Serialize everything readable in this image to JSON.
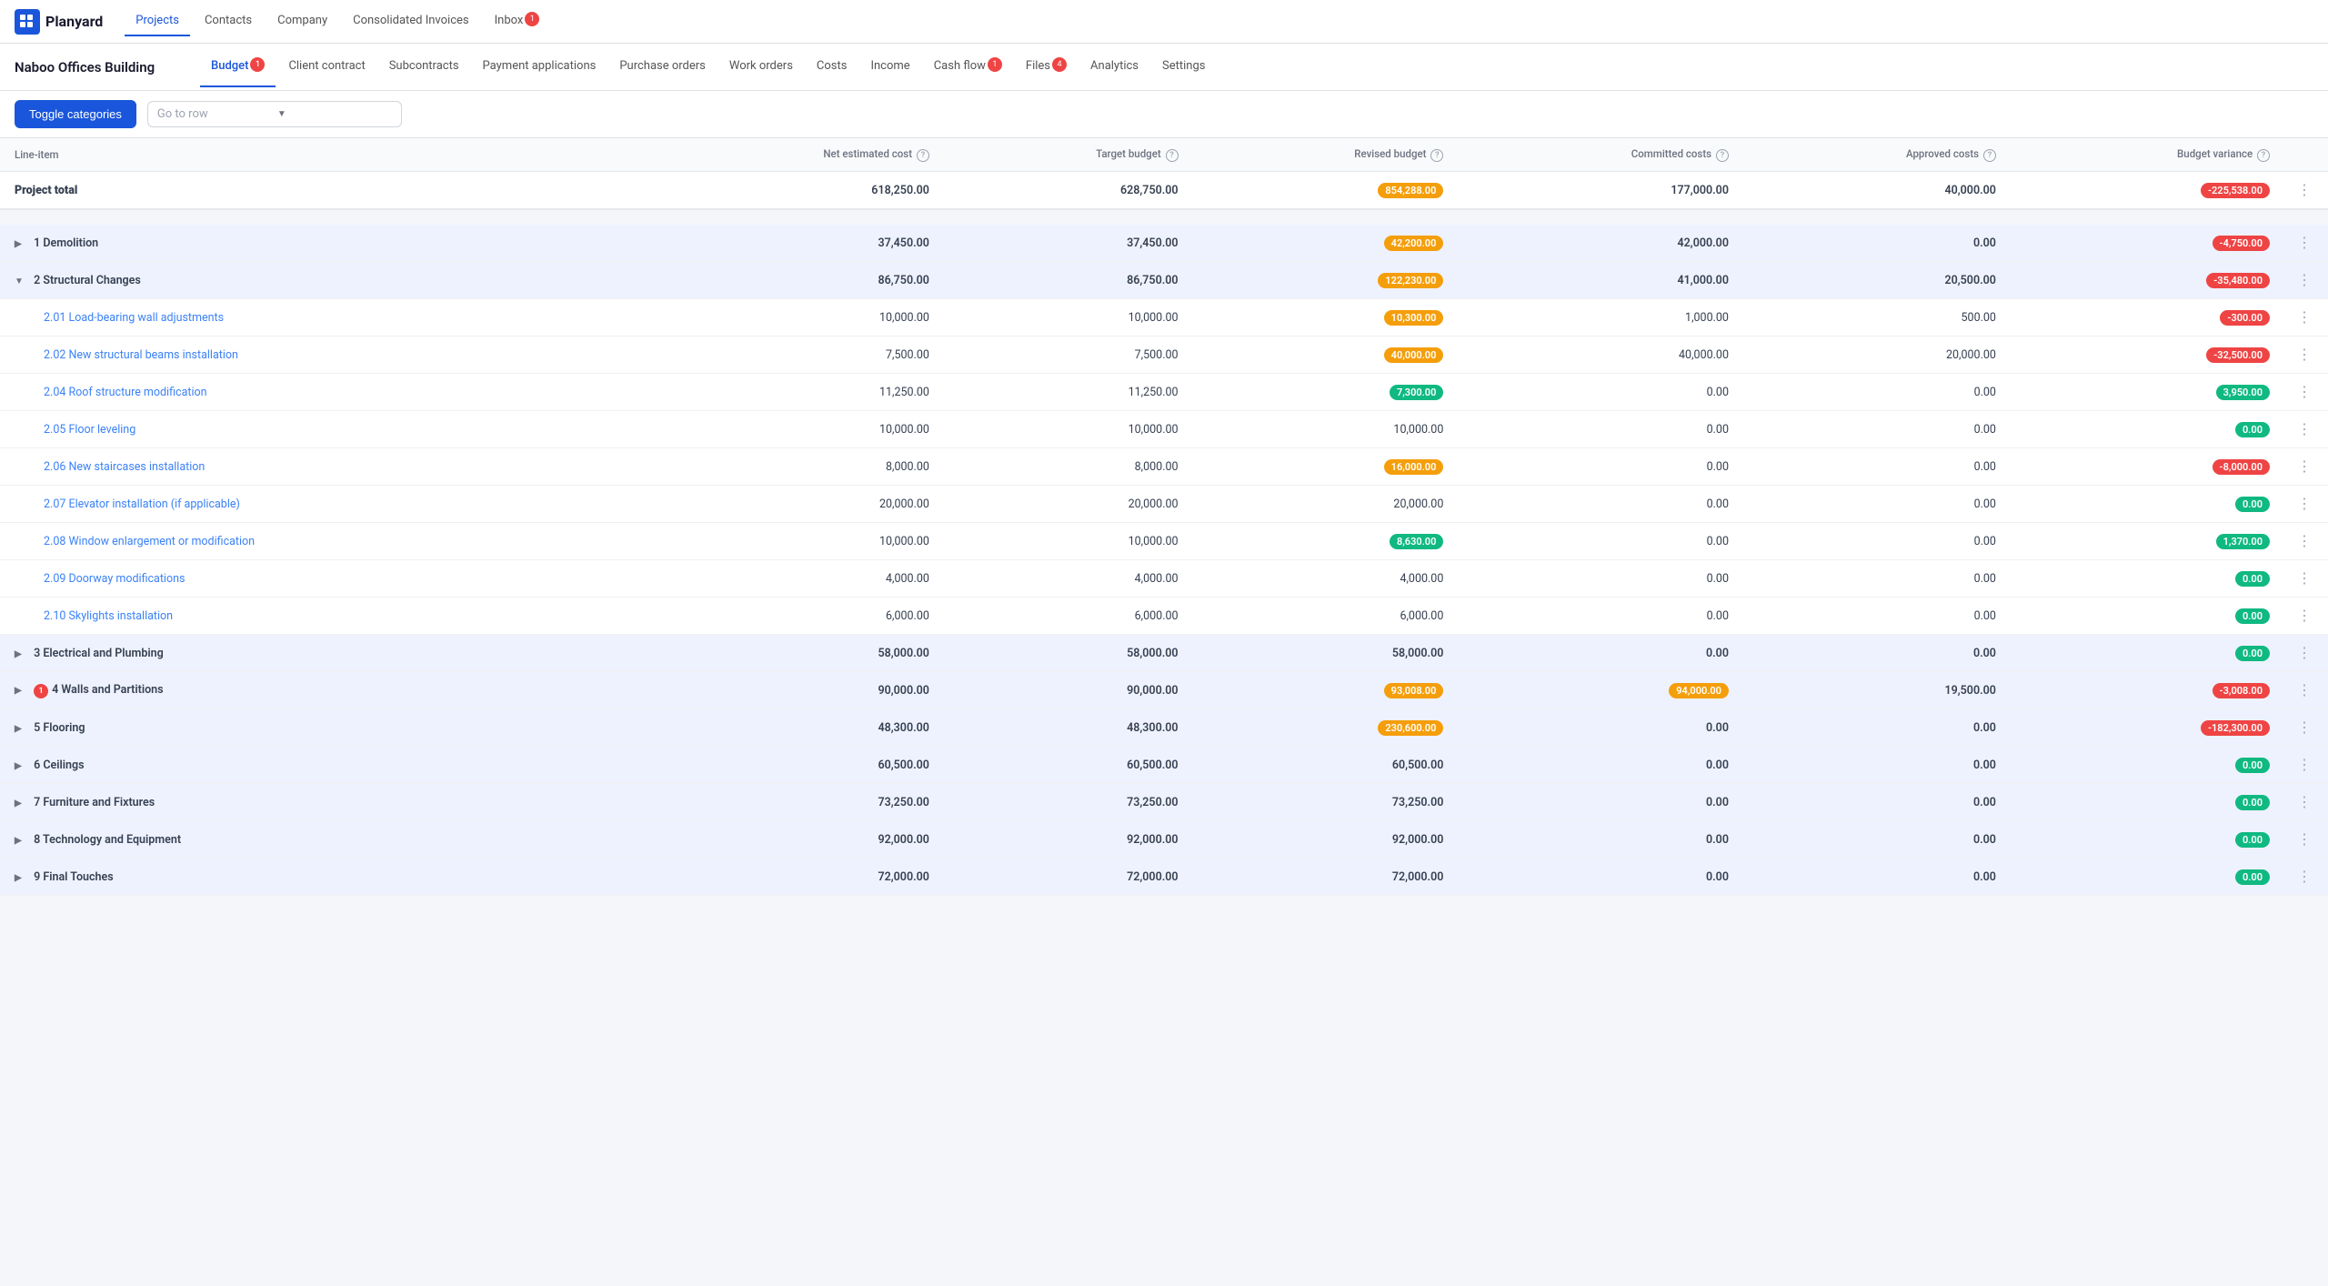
{
  "app": {
    "logo_text": "Planyard",
    "top_nav": [
      {
        "label": "Projects",
        "active": true,
        "badge": null
      },
      {
        "label": "Contacts",
        "active": false,
        "badge": null
      },
      {
        "label": "Company",
        "active": false,
        "badge": null
      },
      {
        "label": "Consolidated Invoices",
        "active": false,
        "badge": null
      },
      {
        "label": "Inbox",
        "active": false,
        "badge": "1"
      }
    ]
  },
  "project": {
    "title": "Naboo Offices Building",
    "sub_nav": [
      {
        "label": "Budget",
        "active": true,
        "badge": "1"
      },
      {
        "label": "Client contract",
        "active": false,
        "badge": null
      },
      {
        "label": "Subcontracts",
        "active": false,
        "badge": null
      },
      {
        "label": "Payment applications",
        "active": false,
        "badge": null
      },
      {
        "label": "Purchase orders",
        "active": false,
        "badge": null
      },
      {
        "label": "Work orders",
        "active": false,
        "badge": null
      },
      {
        "label": "Costs",
        "active": false,
        "badge": null
      },
      {
        "label": "Income",
        "active": false,
        "badge": null
      },
      {
        "label": "Cash flow",
        "active": false,
        "badge": "1"
      },
      {
        "label": "Files",
        "active": false,
        "badge": "4"
      },
      {
        "label": "Analytics",
        "active": false,
        "badge": null
      },
      {
        "label": "Settings",
        "active": false,
        "badge": null
      }
    ]
  },
  "toolbar": {
    "toggle_label": "Toggle categories",
    "go_to_row_placeholder": "Go to row"
  },
  "table": {
    "columns": [
      {
        "key": "line_item",
        "label": "Line-item"
      },
      {
        "key": "net_estimated_cost",
        "label": "Net estimated cost"
      },
      {
        "key": "target_budget",
        "label": "Target budget"
      },
      {
        "key": "revised_budget",
        "label": "Revised budget"
      },
      {
        "key": "committed_costs",
        "label": "Committed costs"
      },
      {
        "key": "approved_costs",
        "label": "Approved costs"
      },
      {
        "key": "budget_variance",
        "label": "Budget variance"
      }
    ],
    "project_total": {
      "label": "Project total",
      "net_estimated_cost": "618,250.00",
      "target_budget": "628,750.00",
      "revised_budget": "854,288.00",
      "revised_budget_style": "orange",
      "committed_costs": "177,000.00",
      "approved_costs": "40,000.00",
      "budget_variance": "-225,538.00",
      "budget_variance_style": "red"
    },
    "rows": [
      {
        "type": "category",
        "id": "1",
        "label": "1 Demolition",
        "expanded": false,
        "net_estimated_cost": "37,450.00",
        "target_budget": "37,450.00",
        "revised_budget": "42,200.00",
        "revised_budget_style": "orange",
        "committed_costs": "42,000.00",
        "approved_costs": "0.00",
        "budget_variance": "-4,750.00",
        "budget_variance_style": "red"
      },
      {
        "type": "category",
        "id": "2",
        "label": "2 Structural Changes",
        "expanded": true,
        "net_estimated_cost": "86,750.00",
        "target_budget": "86,750.00",
        "revised_budget": "122,230.00",
        "revised_budget_style": "orange",
        "committed_costs": "41,000.00",
        "approved_costs": "20,500.00",
        "budget_variance": "-35,480.00",
        "budget_variance_style": "red"
      },
      {
        "type": "sub",
        "label": "2.01 Load-bearing wall adjustments",
        "net_estimated_cost": "10,000.00",
        "target_budget": "10,000.00",
        "revised_budget": "10,300.00",
        "revised_budget_style": "orange",
        "committed_costs": "1,000.00",
        "approved_costs": "500.00",
        "budget_variance": "-300.00",
        "budget_variance_style": "red"
      },
      {
        "type": "sub",
        "label": "2.02 New structural beams installation",
        "net_estimated_cost": "7,500.00",
        "target_budget": "7,500.00",
        "revised_budget": "40,000.00",
        "revised_budget_style": "orange",
        "committed_costs": "40,000.00",
        "approved_costs": "20,000.00",
        "budget_variance": "-32,500.00",
        "budget_variance_style": "red"
      },
      {
        "type": "sub",
        "label": "2.04 Roof structure modification",
        "net_estimated_cost": "11,250.00",
        "target_budget": "11,250.00",
        "revised_budget": "7,300.00",
        "revised_budget_style": "green",
        "committed_costs": "0.00",
        "approved_costs": "0.00",
        "budget_variance": "3,950.00",
        "budget_variance_style": "green"
      },
      {
        "type": "sub",
        "label": "2.05 Floor leveling",
        "net_estimated_cost": "10,000.00",
        "target_budget": "10,000.00",
        "revised_budget": "10,000.00",
        "revised_budget_style": "none",
        "committed_costs": "0.00",
        "approved_costs": "0.00",
        "budget_variance": "0.00",
        "budget_variance_style": "green"
      },
      {
        "type": "sub",
        "label": "2.06 New staircases installation",
        "net_estimated_cost": "8,000.00",
        "target_budget": "8,000.00",
        "revised_budget": "16,000.00",
        "revised_budget_style": "orange",
        "committed_costs": "0.00",
        "approved_costs": "0.00",
        "budget_variance": "-8,000.00",
        "budget_variance_style": "red"
      },
      {
        "type": "sub",
        "label": "2.07 Elevator installation (if applicable)",
        "net_estimated_cost": "20,000.00",
        "target_budget": "20,000.00",
        "revised_budget": "20,000.00",
        "revised_budget_style": "none",
        "committed_costs": "0.00",
        "approved_costs": "0.00",
        "budget_variance": "0.00",
        "budget_variance_style": "green"
      },
      {
        "type": "sub",
        "label": "2.08 Window enlargement or modification",
        "net_estimated_cost": "10,000.00",
        "target_budget": "10,000.00",
        "revised_budget": "8,630.00",
        "revised_budget_style": "green",
        "committed_costs": "0.00",
        "approved_costs": "0.00",
        "budget_variance": "1,370.00",
        "budget_variance_style": "green"
      },
      {
        "type": "sub",
        "label": "2.09 Doorway modifications",
        "net_estimated_cost": "4,000.00",
        "target_budget": "4,000.00",
        "revised_budget": "4,000.00",
        "revised_budget_style": "none",
        "committed_costs": "0.00",
        "approved_costs": "0.00",
        "budget_variance": "0.00",
        "budget_variance_style": "green"
      },
      {
        "type": "sub",
        "label": "2.10 Skylights installation",
        "net_estimated_cost": "6,000.00",
        "target_budget": "6,000.00",
        "revised_budget": "6,000.00",
        "revised_budget_style": "none",
        "committed_costs": "0.00",
        "approved_costs": "0.00",
        "budget_variance": "0.00",
        "budget_variance_style": "green"
      },
      {
        "type": "category",
        "id": "3",
        "label": "3 Electrical and Plumbing",
        "expanded": false,
        "net_estimated_cost": "58,000.00",
        "target_budget": "58,000.00",
        "revised_budget": "58,000.00",
        "revised_budget_style": "none",
        "committed_costs": "0.00",
        "approved_costs": "0.00",
        "budget_variance": "0.00",
        "budget_variance_style": "green"
      },
      {
        "type": "category",
        "id": "4",
        "label": "4 Walls and Partitions",
        "expanded": false,
        "has_alert": true,
        "net_estimated_cost": "90,000.00",
        "target_budget": "90,000.00",
        "revised_budget": "93,008.00",
        "revised_budget_style": "orange",
        "committed_costs": "94,000.00",
        "committed_costs_style": "orange",
        "approved_costs": "19,500.00",
        "budget_variance": "-3,008.00",
        "budget_variance_style": "red"
      },
      {
        "type": "category",
        "id": "5",
        "label": "5 Flooring",
        "expanded": false,
        "net_estimated_cost": "48,300.00",
        "target_budget": "48,300.00",
        "revised_budget": "230,600.00",
        "revised_budget_style": "orange",
        "committed_costs": "0.00",
        "approved_costs": "0.00",
        "budget_variance": "-182,300.00",
        "budget_variance_style": "red"
      },
      {
        "type": "category",
        "id": "6",
        "label": "6 Ceilings",
        "expanded": false,
        "net_estimated_cost": "60,500.00",
        "target_budget": "60,500.00",
        "revised_budget": "60,500.00",
        "revised_budget_style": "none",
        "committed_costs": "0.00",
        "approved_costs": "0.00",
        "budget_variance": "0.00",
        "budget_variance_style": "green"
      },
      {
        "type": "category",
        "id": "7",
        "label": "7 Furniture and Fixtures",
        "expanded": false,
        "net_estimated_cost": "73,250.00",
        "target_budget": "73,250.00",
        "revised_budget": "73,250.00",
        "revised_budget_style": "none",
        "committed_costs": "0.00",
        "approved_costs": "0.00",
        "budget_variance": "0.00",
        "budget_variance_style": "green"
      },
      {
        "type": "category",
        "id": "8",
        "label": "8 Technology and Equipment",
        "expanded": false,
        "net_estimated_cost": "92,000.00",
        "target_budget": "92,000.00",
        "revised_budget": "92,000.00",
        "revised_budget_style": "none",
        "committed_costs": "0.00",
        "approved_costs": "0.00",
        "budget_variance": "0.00",
        "budget_variance_style": "green"
      },
      {
        "type": "category",
        "id": "9",
        "label": "9 Final Touches",
        "expanded": false,
        "net_estimated_cost": "72,000.00",
        "target_budget": "72,000.00",
        "revised_budget": "72,000.00",
        "revised_budget_style": "none",
        "committed_costs": "0.00",
        "approved_costs": "0.00",
        "budget_variance": "0.00",
        "budget_variance_style": "green"
      }
    ]
  }
}
